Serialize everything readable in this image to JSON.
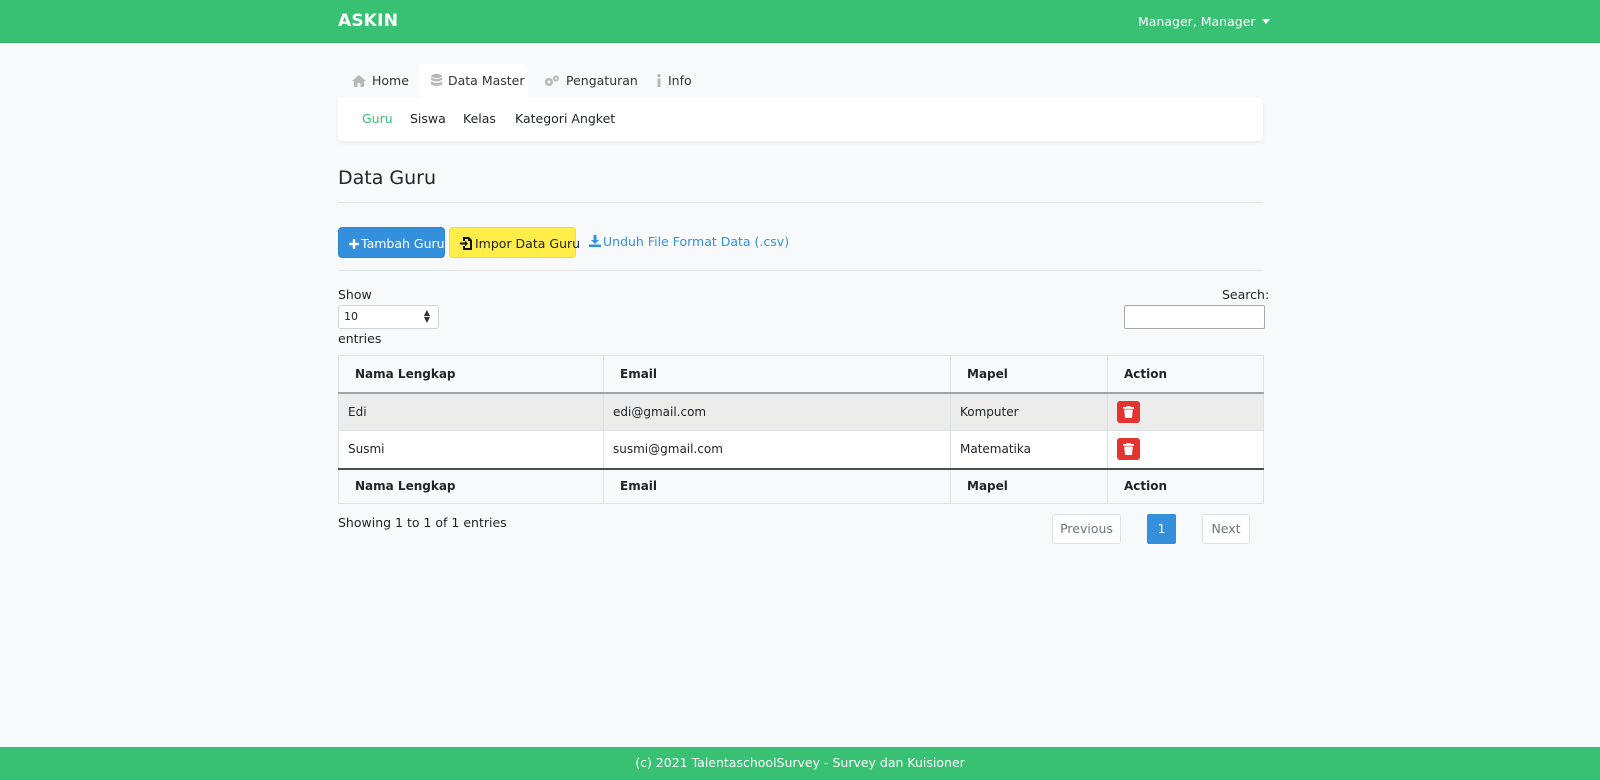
{
  "app": {
    "brand": "ASKIN",
    "user_menu": "Manager, Manager"
  },
  "colors": {
    "brand_green": "#38c172",
    "primary_blue": "#3490dc",
    "warning_yellow": "#ffed4a",
    "danger_red": "#e3342f"
  },
  "nav": {
    "tabs": [
      {
        "label": "Home",
        "icon": "home-icon",
        "active": false
      },
      {
        "label": "Data Master",
        "icon": "database-icon",
        "active": true
      },
      {
        "label": "Pengaturan",
        "icon": "gears-icon",
        "active": false
      },
      {
        "label": "Info",
        "icon": "info-icon",
        "active": false
      }
    ],
    "sub": [
      {
        "label": "Guru",
        "active": true
      },
      {
        "label": "Siswa",
        "active": false
      },
      {
        "label": "Kelas",
        "active": false
      },
      {
        "label": "Kategori Angket",
        "active": false
      }
    ]
  },
  "page": {
    "title": "Data Guru"
  },
  "actions": {
    "add_label": "Tambah Guru",
    "import_label": "Impor Data Guru",
    "download_label": "Unduh File Format Data (.csv)"
  },
  "datatable": {
    "show_label": "Show",
    "entries_label": "entries",
    "length_value": "10",
    "search_label": "Search:",
    "search_value": "",
    "columns": [
      "Nama Lengkap",
      "Email",
      "Mapel",
      "Action"
    ],
    "rows": [
      {
        "nama": "Edi",
        "email": "edi@gmail.com",
        "mapel": "Komputer"
      },
      {
        "nama": "Susmi",
        "email": "susmi@gmail.com",
        "mapel": "Matematika"
      }
    ],
    "info": "Showing 1 to 1 of 1 entries",
    "pagination": {
      "previous": "Previous",
      "current": "1",
      "next": "Next"
    }
  },
  "footer": {
    "text": "(c) 2021 TalentaschoolSurvey - Survey dan Kuisioner"
  }
}
